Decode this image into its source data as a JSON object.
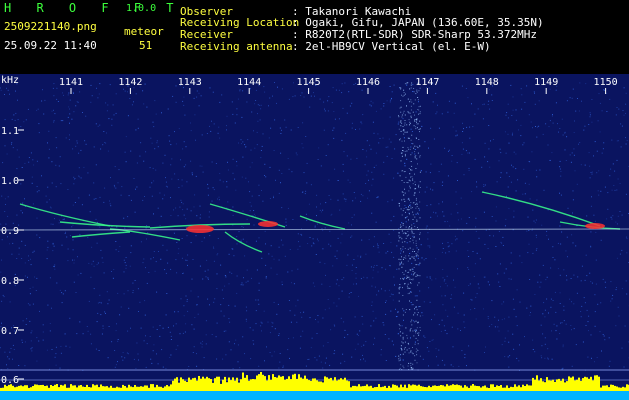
{
  "header": {
    "brand": "H R O F F T",
    "version": "1.0.0",
    "filename": "2509221140.png",
    "timestamp": "25.09.22 11:40",
    "meteor_label": "meteor",
    "meteor_count": "51",
    "info_labels": [
      "Observer",
      "Receiving Location",
      "Receiver",
      "Receiving antenna"
    ],
    "info_values": [
      ": Takanori Kawachi",
      ": Ogaki, Gifu, JAPAN (136.60E, 35.35N)",
      ": R820T2(RTL-SDR) SDR-Sharp 53.372MHz",
      ": 2el-HB9CV Vertical (el. E-W)"
    ]
  },
  "spectrogram": {
    "unit_label": "kHz",
    "time_ticks": [
      "1141",
      "1142",
      "1143",
      "1144",
      "1145",
      "1146",
      "1147",
      "1148",
      "1149",
      "1150"
    ],
    "freq_ticks": [
      "1.1",
      "1.0",
      "0.9",
      "0.8",
      "0.7",
      "0.6"
    ],
    "colors": {
      "background": "#0a1460",
      "noise": "#3c78ff",
      "trace": "#39ff8c",
      "hot": "#ff3030",
      "level_bar": "#ffff00",
      "level_base": "#00b4ff"
    }
  }
}
